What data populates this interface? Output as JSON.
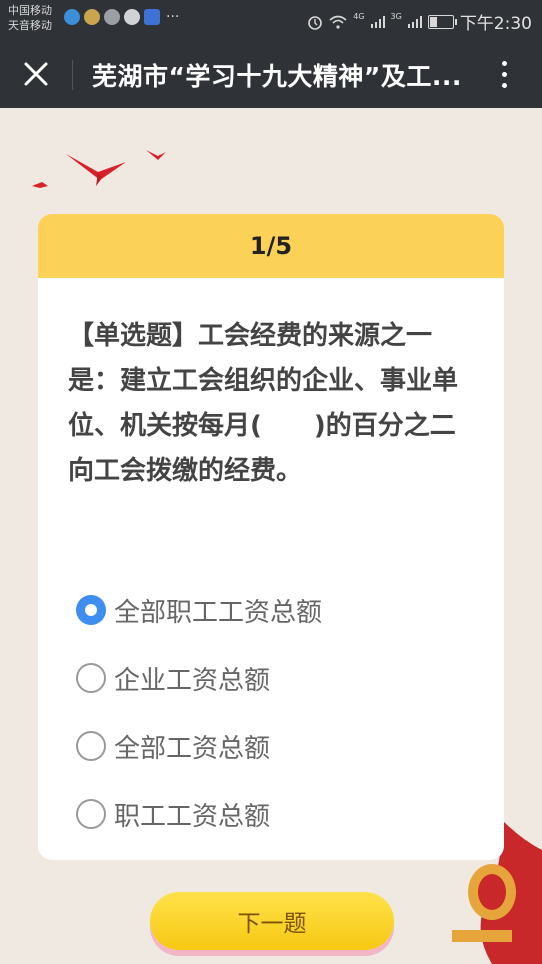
{
  "status_bar": {
    "carrier_1": "中国移动",
    "carrier_2": "天音移动",
    "more_dots": "···",
    "network_1": "4G",
    "network_2": "3G",
    "time": "下午2:30",
    "icons": [
      "app-q-icon",
      "weather-icon",
      "wechat-icon",
      "qq-icon",
      "baidu-icon",
      "alarm-icon",
      "wifi-icon",
      "signal-icon",
      "battery-icon"
    ]
  },
  "nav": {
    "title": "芜湖市“学习十九大精神”及工...",
    "close_icon": "close-icon",
    "more_icon": "more-vertical-icon"
  },
  "quiz": {
    "progress": "1/5",
    "question": "【单选题】工会经费的来源之一是：建立工会组织的企业、事业单位、机关按每月(　　)的百分之二向工会拨缴的经费。",
    "options": [
      {
        "label": "全部职工工资总额",
        "selected": true
      },
      {
        "label": "企业工资总额",
        "selected": false
      },
      {
        "label": "全部工资总额",
        "selected": false
      },
      {
        "label": "职工工资总额",
        "selected": false
      }
    ],
    "next_label": "下一题"
  },
  "colors": {
    "header_bar": "#2f3236",
    "card_header": "#fcd158",
    "radio_checked": "#3d8ef0",
    "button": "#f7c813"
  }
}
